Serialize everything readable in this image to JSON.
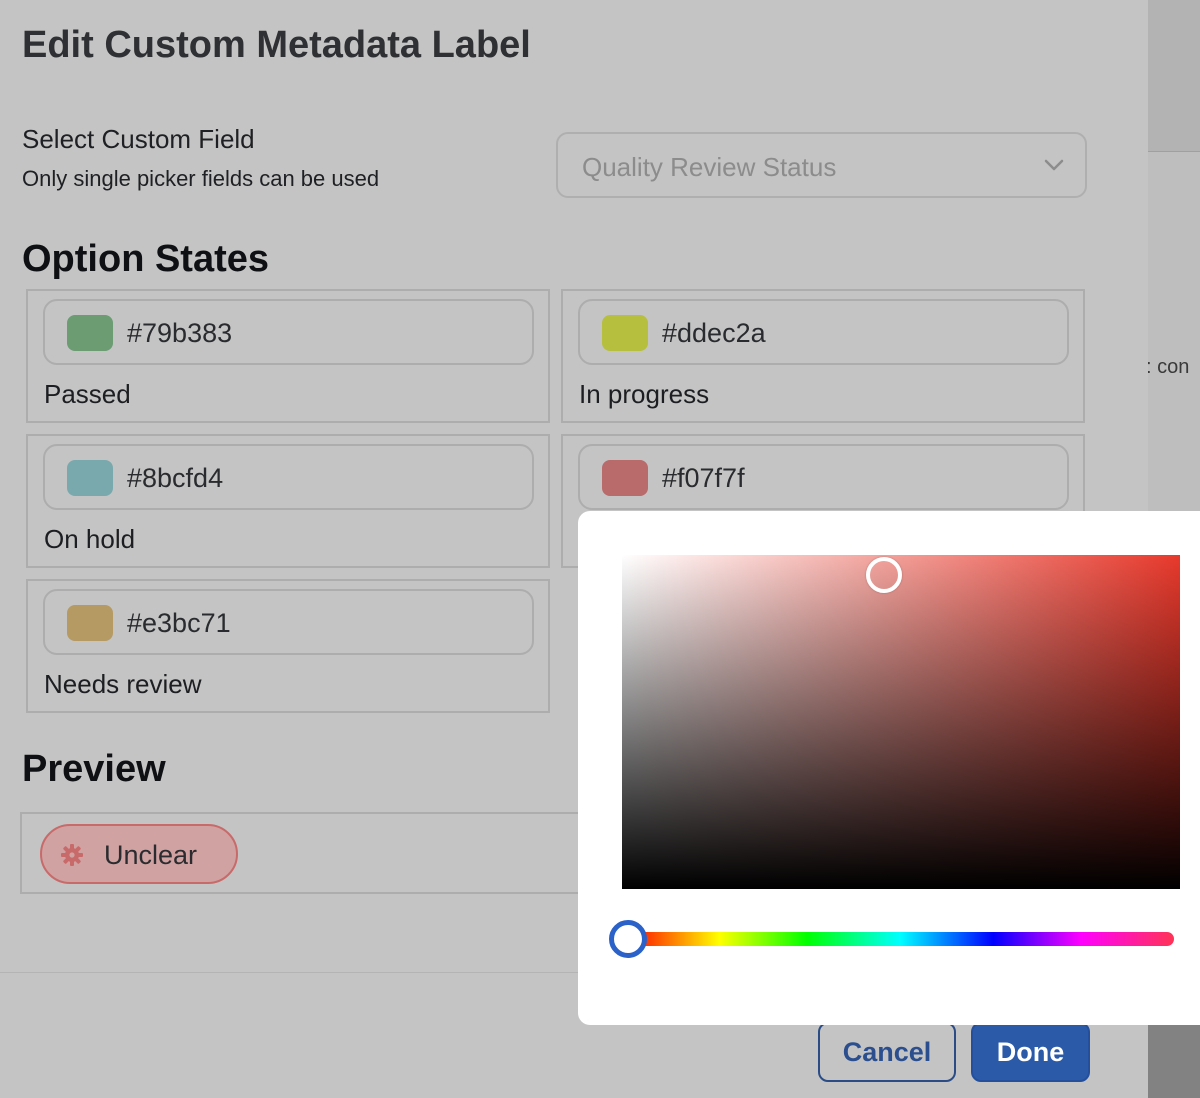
{
  "modal": {
    "title": "Edit Custom Metadata Label",
    "custom_field": {
      "label": "Select Custom Field",
      "hint": "Only single picker fields can be used",
      "selected": "Quality Review Status"
    },
    "option_states_title": "Option States",
    "option_states": [
      {
        "color": "#79b383",
        "swatch": "#6b9c72",
        "label": "Passed"
      },
      {
        "color": "#ddec2a",
        "swatch": "#b6bf3e",
        "label": "In progress"
      },
      {
        "color": "#8bcfd4",
        "swatch": "#7aa9ad",
        "label": "On hold"
      },
      {
        "color": "#f07f7f",
        "swatch": "#b96a6a",
        "label": ""
      },
      {
        "color": "#e3bc71",
        "swatch": "#b59a63",
        "label": "Needs review"
      }
    ],
    "preview_title": "Preview",
    "preview_pill": {
      "label": "Unclear",
      "icon": "gear-icon"
    },
    "buttons": {
      "cancel": "Cancel",
      "done": "Done"
    }
  },
  "background_page": {
    "snippet": ": con"
  },
  "color_picker": {
    "base_hue_color": "#e8392c",
    "hue_handle": "blue-ring"
  }
}
